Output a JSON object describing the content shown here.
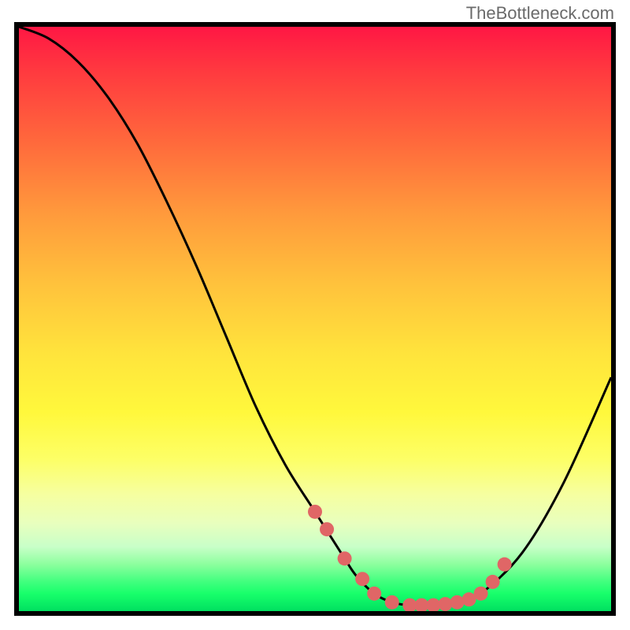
{
  "watermark": "TheBottleneck.com",
  "chart_data": {
    "type": "line",
    "title": "",
    "xlabel": "",
    "ylabel": "",
    "xlim": [
      0,
      100
    ],
    "ylim": [
      0,
      100
    ],
    "series": [
      {
        "name": "curve",
        "x": [
          0,
          5,
          10,
          15,
          20,
          25,
          30,
          35,
          40,
          45,
          50,
          55,
          57,
          60,
          63,
          66,
          70,
          74,
          78,
          85,
          92,
          100
        ],
        "y": [
          100,
          98,
          94,
          88,
          80,
          70,
          59,
          47,
          35,
          25,
          17,
          9,
          6,
          3,
          1.5,
          1,
          1,
          1.5,
          3,
          10,
          22,
          40
        ],
        "color": "#000000"
      }
    ],
    "highlight_dots": {
      "x": [
        50,
        52,
        55,
        58,
        60,
        63,
        66,
        68,
        70,
        72,
        74,
        76,
        78,
        80,
        82
      ],
      "y": [
        17,
        14,
        9,
        5.5,
        3,
        1.5,
        1,
        1,
        1,
        1.2,
        1.5,
        2,
        3,
        5,
        8
      ],
      "color": "#e06666",
      "radius": 9
    },
    "gradient_stops": [
      {
        "pos": 0.0,
        "color": "#ff1744"
      },
      {
        "pos": 0.08,
        "color": "#ff3b3f"
      },
      {
        "pos": 0.2,
        "color": "#ff6a3c"
      },
      {
        "pos": 0.32,
        "color": "#ff9a3c"
      },
      {
        "pos": 0.44,
        "color": "#ffc23c"
      },
      {
        "pos": 0.56,
        "color": "#ffe43c"
      },
      {
        "pos": 0.66,
        "color": "#fff83c"
      },
      {
        "pos": 0.74,
        "color": "#fdff66"
      },
      {
        "pos": 0.8,
        "color": "#f6ffa0"
      },
      {
        "pos": 0.85,
        "color": "#e8ffbe"
      },
      {
        "pos": 0.89,
        "color": "#c8ffc8"
      },
      {
        "pos": 0.92,
        "color": "#8cff9e"
      },
      {
        "pos": 0.95,
        "color": "#40ff7e"
      },
      {
        "pos": 0.97,
        "color": "#18ff6b"
      },
      {
        "pos": 1.0,
        "color": "#00e060"
      }
    ]
  }
}
